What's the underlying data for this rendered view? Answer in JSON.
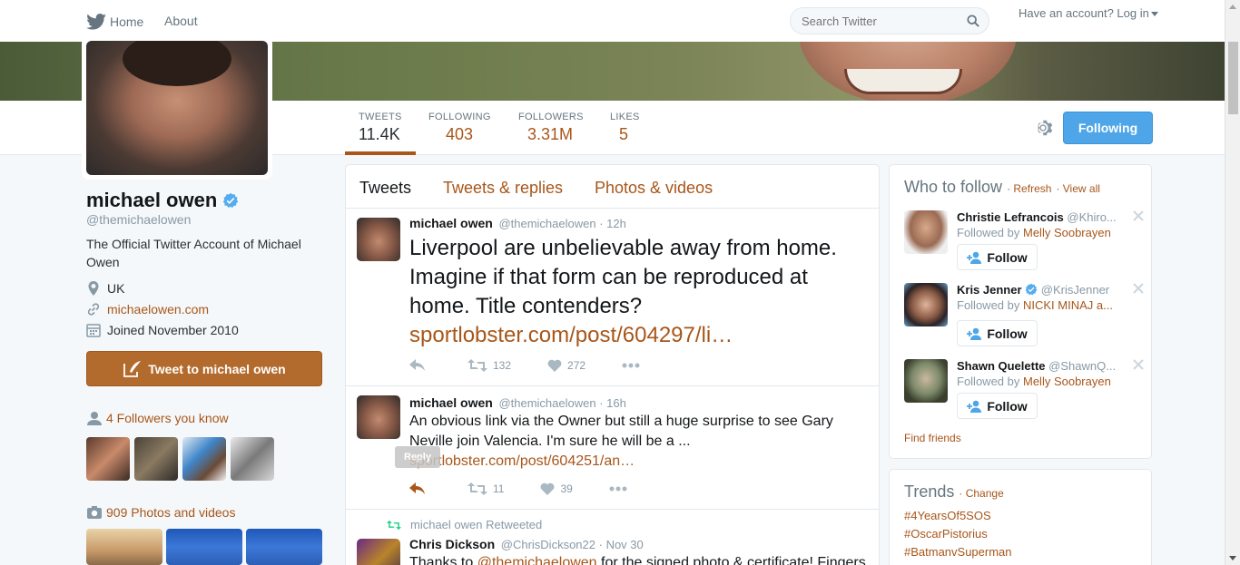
{
  "nav": {
    "home_label": "Home",
    "about_label": "About",
    "search_placeholder": "Search Twitter",
    "login_label": "Have an account? Log in"
  },
  "colors": {
    "accent": "#a8561a",
    "follow_blue": "#4ea5e8",
    "tweet_button": "#b36b2d"
  },
  "stats": [
    {
      "label": "TWEETS",
      "value": "11.4K"
    },
    {
      "label": "FOLLOWING",
      "value": "403"
    },
    {
      "label": "FOLLOWERS",
      "value": "3.31M"
    },
    {
      "label": "LIKES",
      "value": "5"
    }
  ],
  "following_button": "Following",
  "profile": {
    "name": "michael owen",
    "handle": "@themichaelowen",
    "bio": "The Official Twitter Account of Michael Owen",
    "location": "UK",
    "website": "michaelowen.com",
    "joined": "Joined November 2010",
    "tweet_to_label": "Tweet to michael owen",
    "followers_you_know": "4 Followers you know",
    "photos_videos": "909 Photos and videos"
  },
  "timeline": {
    "tabs": [
      "Tweets",
      "Tweets & replies",
      "Photos & videos"
    ],
    "tweets": [
      {
        "name": "michael owen",
        "handle": "@themichaelowen",
        "time": "· 12h",
        "text": "Liverpool are unbelievable away from home. Imagine if that form can be reproduced at home. Title contenders?",
        "link": "sportlobster.com/post/604297/li…",
        "retweets": "132",
        "likes": "272"
      },
      {
        "name": "michael owen",
        "handle": "@themichaelowen",
        "time": "· 16h",
        "text": "An obvious link via the Owner but still a huge surprise to see Gary Neville join Valencia. I'm sure he will be a ...",
        "link": "sportlobster.com/post/604251/an…",
        "retweets": "11",
        "likes": "39",
        "tooltip": "Reply"
      },
      {
        "retweeted_by": "michael owen Retweeted",
        "name": "Chris Dickson",
        "handle": "@ChrisDickson22",
        "time": "· Nov 30",
        "text_prefix": "Thanks to ",
        "mention": "@themichaelowen",
        "text_suffix": " for the signed photo & certificate! Fingers"
      }
    ]
  },
  "who_to_follow": {
    "title": "Who to follow",
    "refresh": "· Refresh",
    "view_all": "· View all",
    "follow_label": "Follow",
    "followed_by_prefix": "Followed by",
    "items": [
      {
        "name": "Christie Lefrancois",
        "handle": "@Khiro...",
        "followed_by": "Melly Soobrayen"
      },
      {
        "name": "Kris Jenner",
        "handle": "@KrisJenner",
        "followed_by": "NICKI MINAJ a..."
      },
      {
        "name": "Shawn Quelette",
        "handle": "@ShawnQ...",
        "followed_by": "Melly Soobrayen"
      }
    ],
    "find_friends": "Find friends"
  },
  "trends": {
    "title": "Trends",
    "change": "· Change",
    "items": [
      "#4YearsOf5SOS",
      "#OscarPistorius",
      "#BatmanvSuperman"
    ]
  }
}
